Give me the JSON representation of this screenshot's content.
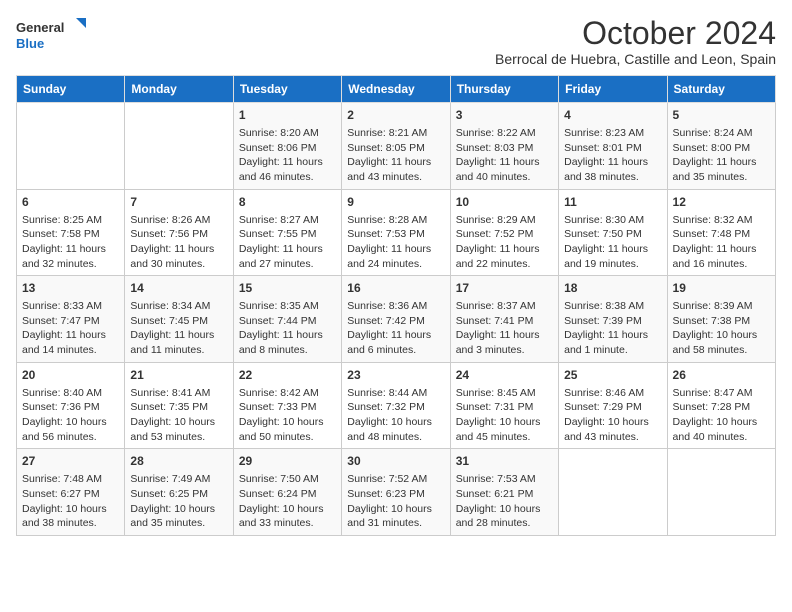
{
  "logo": {
    "text_general": "General",
    "text_blue": "Blue"
  },
  "title": "October 2024",
  "subtitle": "Berrocal de Huebra, Castille and Leon, Spain",
  "days_of_week": [
    "Sunday",
    "Monday",
    "Tuesday",
    "Wednesday",
    "Thursday",
    "Friday",
    "Saturday"
  ],
  "weeks": [
    [
      {
        "day": "",
        "sunrise": "",
        "sunset": "",
        "daylight": ""
      },
      {
        "day": "",
        "sunrise": "",
        "sunset": "",
        "daylight": ""
      },
      {
        "day": "1",
        "sunrise": "Sunrise: 8:20 AM",
        "sunset": "Sunset: 8:06 PM",
        "daylight": "Daylight: 11 hours and 46 minutes."
      },
      {
        "day": "2",
        "sunrise": "Sunrise: 8:21 AM",
        "sunset": "Sunset: 8:05 PM",
        "daylight": "Daylight: 11 hours and 43 minutes."
      },
      {
        "day": "3",
        "sunrise": "Sunrise: 8:22 AM",
        "sunset": "Sunset: 8:03 PM",
        "daylight": "Daylight: 11 hours and 40 minutes."
      },
      {
        "day": "4",
        "sunrise": "Sunrise: 8:23 AM",
        "sunset": "Sunset: 8:01 PM",
        "daylight": "Daylight: 11 hours and 38 minutes."
      },
      {
        "day": "5",
        "sunrise": "Sunrise: 8:24 AM",
        "sunset": "Sunset: 8:00 PM",
        "daylight": "Daylight: 11 hours and 35 minutes."
      }
    ],
    [
      {
        "day": "6",
        "sunrise": "Sunrise: 8:25 AM",
        "sunset": "Sunset: 7:58 PM",
        "daylight": "Daylight: 11 hours and 32 minutes."
      },
      {
        "day": "7",
        "sunrise": "Sunrise: 8:26 AM",
        "sunset": "Sunset: 7:56 PM",
        "daylight": "Daylight: 11 hours and 30 minutes."
      },
      {
        "day": "8",
        "sunrise": "Sunrise: 8:27 AM",
        "sunset": "Sunset: 7:55 PM",
        "daylight": "Daylight: 11 hours and 27 minutes."
      },
      {
        "day": "9",
        "sunrise": "Sunrise: 8:28 AM",
        "sunset": "Sunset: 7:53 PM",
        "daylight": "Daylight: 11 hours and 24 minutes."
      },
      {
        "day": "10",
        "sunrise": "Sunrise: 8:29 AM",
        "sunset": "Sunset: 7:52 PM",
        "daylight": "Daylight: 11 hours and 22 minutes."
      },
      {
        "day": "11",
        "sunrise": "Sunrise: 8:30 AM",
        "sunset": "Sunset: 7:50 PM",
        "daylight": "Daylight: 11 hours and 19 minutes."
      },
      {
        "day": "12",
        "sunrise": "Sunrise: 8:32 AM",
        "sunset": "Sunset: 7:48 PM",
        "daylight": "Daylight: 11 hours and 16 minutes."
      }
    ],
    [
      {
        "day": "13",
        "sunrise": "Sunrise: 8:33 AM",
        "sunset": "Sunset: 7:47 PM",
        "daylight": "Daylight: 11 hours and 14 minutes."
      },
      {
        "day": "14",
        "sunrise": "Sunrise: 8:34 AM",
        "sunset": "Sunset: 7:45 PM",
        "daylight": "Daylight: 11 hours and 11 minutes."
      },
      {
        "day": "15",
        "sunrise": "Sunrise: 8:35 AM",
        "sunset": "Sunset: 7:44 PM",
        "daylight": "Daylight: 11 hours and 8 minutes."
      },
      {
        "day": "16",
        "sunrise": "Sunrise: 8:36 AM",
        "sunset": "Sunset: 7:42 PM",
        "daylight": "Daylight: 11 hours and 6 minutes."
      },
      {
        "day": "17",
        "sunrise": "Sunrise: 8:37 AM",
        "sunset": "Sunset: 7:41 PM",
        "daylight": "Daylight: 11 hours and 3 minutes."
      },
      {
        "day": "18",
        "sunrise": "Sunrise: 8:38 AM",
        "sunset": "Sunset: 7:39 PM",
        "daylight": "Daylight: 11 hours and 1 minute."
      },
      {
        "day": "19",
        "sunrise": "Sunrise: 8:39 AM",
        "sunset": "Sunset: 7:38 PM",
        "daylight": "Daylight: 10 hours and 58 minutes."
      }
    ],
    [
      {
        "day": "20",
        "sunrise": "Sunrise: 8:40 AM",
        "sunset": "Sunset: 7:36 PM",
        "daylight": "Daylight: 10 hours and 56 minutes."
      },
      {
        "day": "21",
        "sunrise": "Sunrise: 8:41 AM",
        "sunset": "Sunset: 7:35 PM",
        "daylight": "Daylight: 10 hours and 53 minutes."
      },
      {
        "day": "22",
        "sunrise": "Sunrise: 8:42 AM",
        "sunset": "Sunset: 7:33 PM",
        "daylight": "Daylight: 10 hours and 50 minutes."
      },
      {
        "day": "23",
        "sunrise": "Sunrise: 8:44 AM",
        "sunset": "Sunset: 7:32 PM",
        "daylight": "Daylight: 10 hours and 48 minutes."
      },
      {
        "day": "24",
        "sunrise": "Sunrise: 8:45 AM",
        "sunset": "Sunset: 7:31 PM",
        "daylight": "Daylight: 10 hours and 45 minutes."
      },
      {
        "day": "25",
        "sunrise": "Sunrise: 8:46 AM",
        "sunset": "Sunset: 7:29 PM",
        "daylight": "Daylight: 10 hours and 43 minutes."
      },
      {
        "day": "26",
        "sunrise": "Sunrise: 8:47 AM",
        "sunset": "Sunset: 7:28 PM",
        "daylight": "Daylight: 10 hours and 40 minutes."
      }
    ],
    [
      {
        "day": "27",
        "sunrise": "Sunrise: 7:48 AM",
        "sunset": "Sunset: 6:27 PM",
        "daylight": "Daylight: 10 hours and 38 minutes."
      },
      {
        "day": "28",
        "sunrise": "Sunrise: 7:49 AM",
        "sunset": "Sunset: 6:25 PM",
        "daylight": "Daylight: 10 hours and 35 minutes."
      },
      {
        "day": "29",
        "sunrise": "Sunrise: 7:50 AM",
        "sunset": "Sunset: 6:24 PM",
        "daylight": "Daylight: 10 hours and 33 minutes."
      },
      {
        "day": "30",
        "sunrise": "Sunrise: 7:52 AM",
        "sunset": "Sunset: 6:23 PM",
        "daylight": "Daylight: 10 hours and 31 minutes."
      },
      {
        "day": "31",
        "sunrise": "Sunrise: 7:53 AM",
        "sunset": "Sunset: 6:21 PM",
        "daylight": "Daylight: 10 hours and 28 minutes."
      },
      {
        "day": "",
        "sunrise": "",
        "sunset": "",
        "daylight": ""
      },
      {
        "day": "",
        "sunrise": "",
        "sunset": "",
        "daylight": ""
      }
    ]
  ]
}
